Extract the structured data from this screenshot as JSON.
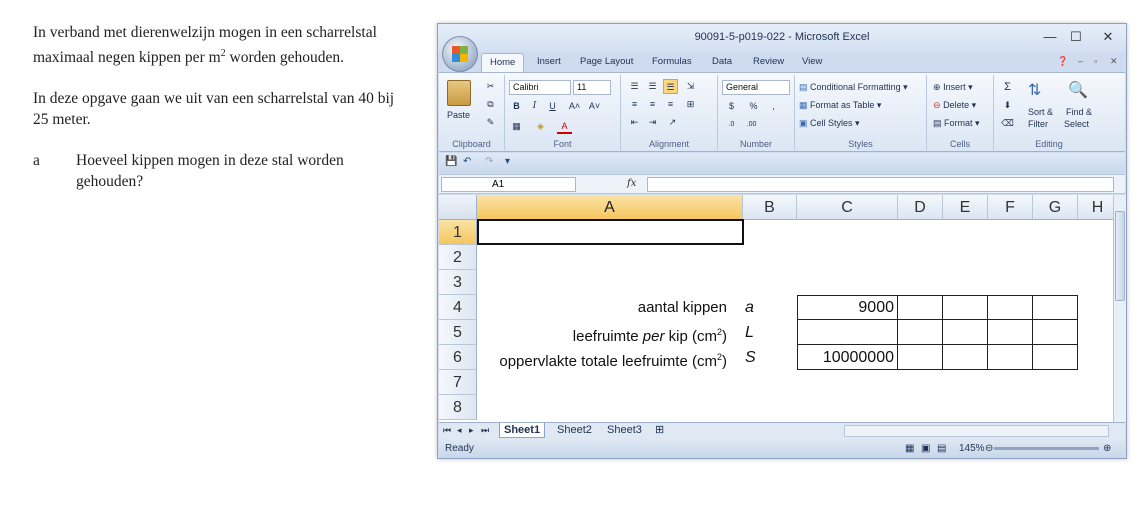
{
  "doc": {
    "p1_a": "In verband met dierenwelzijn mogen in een scharrelstal maximaal negen kippen per m",
    "p1_sup": "2",
    "p1_b": " worden gehouden.",
    "p2": "In deze opgave gaan we uit van een scharrelstal van 40 bij 25 meter.",
    "q_label": "a",
    "q_text": "Hoeveel kippen mogen in deze stal worden gehouden?"
  },
  "window": {
    "title": "90091-5-p019-022 - Microsoft Excel",
    "minimize": "—",
    "maximize": "☐",
    "close": "✕"
  },
  "tabs": [
    "Home",
    "Insert",
    "Page Layout",
    "Formulas",
    "Data",
    "Review",
    "View"
  ],
  "ribbon": {
    "clipboard": {
      "label": "Clipboard",
      "paste": "Paste"
    },
    "font": {
      "label": "Font",
      "name": "Calibri",
      "size": "11"
    },
    "alignment": {
      "label": "Alignment"
    },
    "number": {
      "label": "Number",
      "format": "General",
      "currency": "$",
      "percent": "%",
      "comma": ","
    },
    "styles": {
      "label": "Styles",
      "conditional": "Conditional Formatting",
      "table": "Format as Table",
      "cell": "Cell Styles"
    },
    "cells": {
      "label": "Cells",
      "insert": "Insert",
      "delete": "Delete",
      "format": "Format"
    },
    "editing": {
      "label": "Editing",
      "sum": "Σ",
      "sort": "Sort &",
      "filter": "Filter",
      "find": "Find &",
      "select": "Select"
    }
  },
  "formula_bar": {
    "name_box": "A1",
    "fx": "fx",
    "value": ""
  },
  "columns": [
    "A",
    "B",
    "C",
    "D",
    "E",
    "F",
    "G",
    "H"
  ],
  "rows": [
    "1",
    "2",
    "3",
    "4",
    "5",
    "6",
    "7",
    "8"
  ],
  "cells": {
    "a4": "aantal kippen",
    "b4": "a",
    "c4": "9000",
    "a5_pre": "leefruimte ",
    "a5_em": "per",
    "a5_post": " kip (cm",
    "a5_sup": "2",
    "a5_close": ")",
    "b5": "L",
    "c5": "",
    "a6_pre": "oppervlakte totale leefruimte (cm",
    "a6_sup": "2",
    "a6_close": ")",
    "b6": "S",
    "c6": "10000000"
  },
  "sheets": [
    "Sheet1",
    "Sheet2",
    "Sheet3"
  ],
  "status": {
    "ready": "Ready",
    "zoom": "145%"
  }
}
